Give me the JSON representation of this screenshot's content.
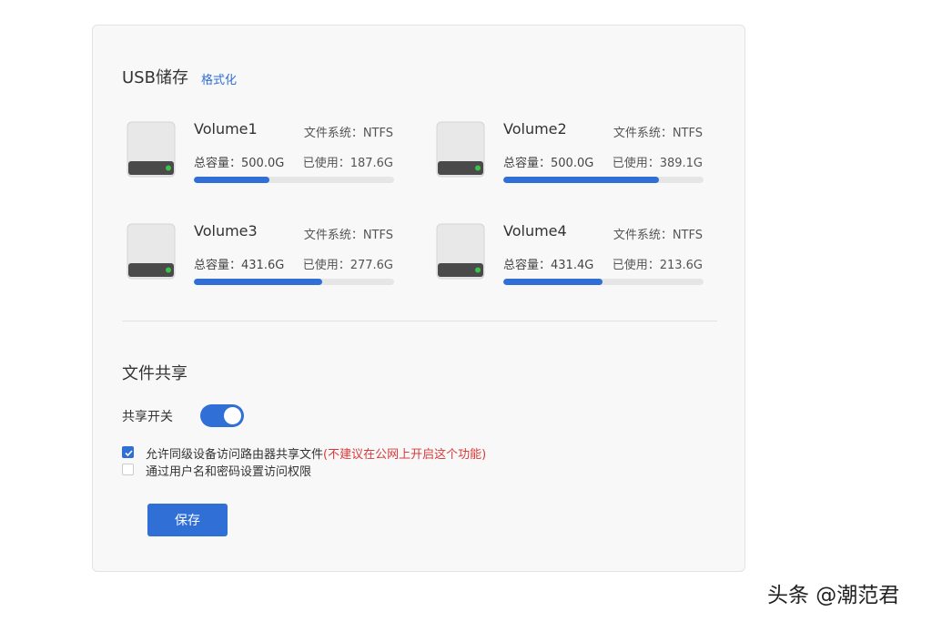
{
  "usb_storage": {
    "title": "USB储存",
    "format_link": "格式化",
    "volumes": [
      {
        "name": "Volume1",
        "filesystem": "文件系统：NTFS",
        "capacity": "总容量：500.0G",
        "used": "已使用：187.6G",
        "usage_ratio": 0.375
      },
      {
        "name": "Volume2",
        "filesystem": "文件系统：NTFS",
        "capacity": "总容量：500.0G",
        "used": "已使用：389.1G",
        "usage_ratio": 0.778
      },
      {
        "name": "Volume3",
        "filesystem": "文件系统：NTFS",
        "capacity": "总容量：431.6G",
        "used": "已使用：277.6G",
        "usage_ratio": 0.643
      },
      {
        "name": "Volume4",
        "filesystem": "文件系统：NTFS",
        "capacity": "总容量：431.4G",
        "used": "已使用：213.6G",
        "usage_ratio": 0.495
      }
    ]
  },
  "file_sharing": {
    "title": "文件共享",
    "toggle_label": "共享开关",
    "toggle_on": true,
    "options": [
      {
        "label": "允许同级设备访问路由器共享文件",
        "note": "(不建议在公网上开启这个功能)",
        "checked": true
      },
      {
        "label": "通过用户名和密码设置访问权限",
        "note": "",
        "checked": false
      }
    ],
    "save_label": "保存"
  },
  "watermark": "头条 @潮范君",
  "colors": {
    "accent": "#2f6fd6",
    "warning": "#d93a3a",
    "drive_led": "#3cc24a"
  },
  "icons": {
    "drive": "hard-drive-icon",
    "check": "check-icon"
  }
}
